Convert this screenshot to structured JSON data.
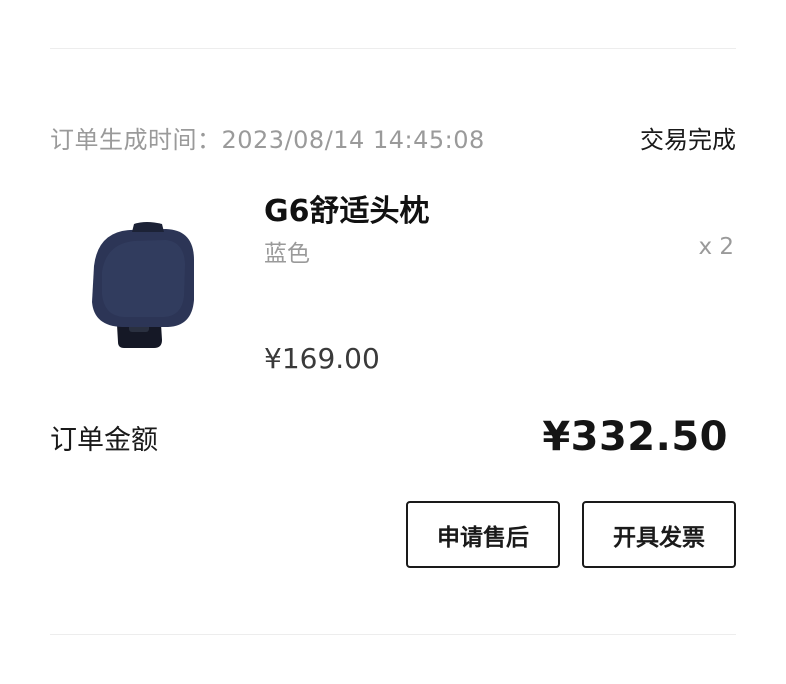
{
  "order": {
    "time_label": "订单生成时间：2023/08/14 14:45:08",
    "status": "交易完成"
  },
  "product": {
    "name": "G6舒适头枕",
    "variant": "蓝色",
    "quantity": "x 2",
    "price": "¥169.00",
    "image_icon": "headrest-pillow-image",
    "image_color": "#2b3350"
  },
  "summary": {
    "total_label": "订单金额",
    "total_amount": "¥332.50"
  },
  "actions": {
    "after_sales_label": "申请售后",
    "invoice_label": "开具发票"
  }
}
